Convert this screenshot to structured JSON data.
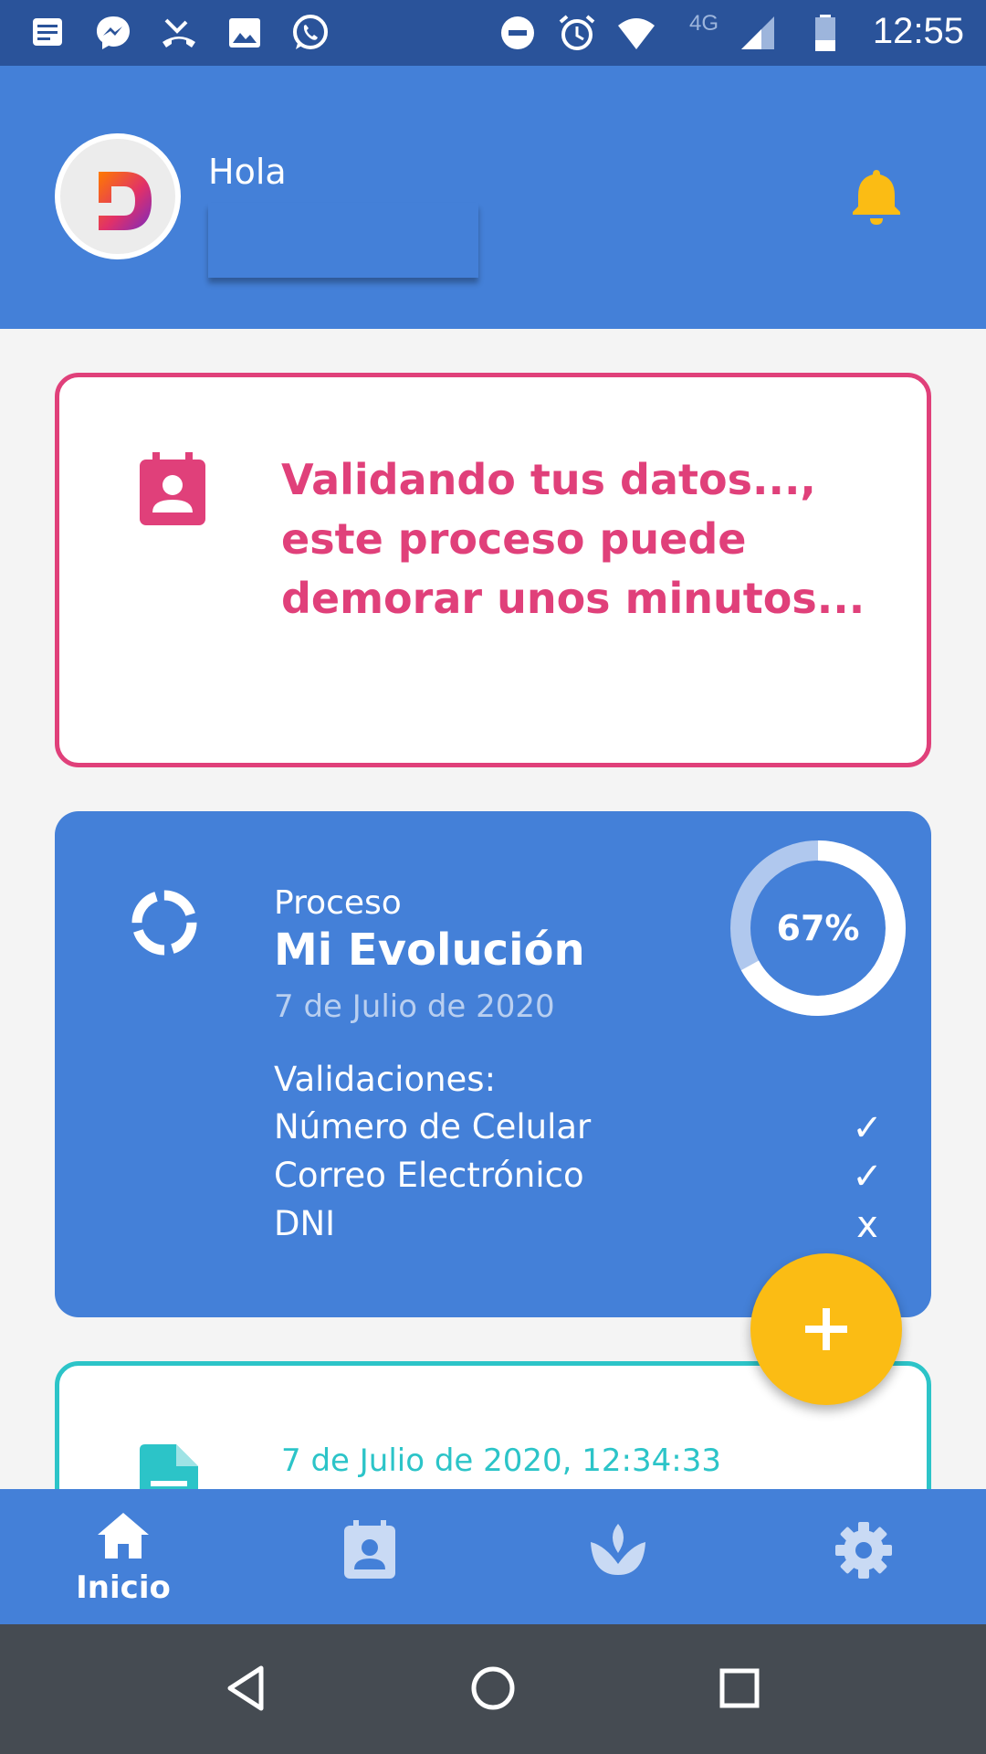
{
  "status_bar": {
    "time": "12:55",
    "network": "4G",
    "icons": [
      "notes-icon",
      "messenger-icon",
      "missed-call-icon",
      "image-icon",
      "whatsapp-icon",
      "do-not-disturb-icon",
      "alarm-icon",
      "wifi-icon",
      "signal-icon",
      "battery-icon"
    ]
  },
  "header": {
    "greeting": "Hola",
    "username": "",
    "bell_color": "#fbbc14",
    "bg_color": "#4480d8"
  },
  "validation_card": {
    "message": "Validando tus datos..., este proceso puede demorar unos minutos...",
    "icon": "contact-calendar-icon",
    "color": "#e0407a"
  },
  "process_card": {
    "label": "Proceso",
    "title": "Mi Evolución",
    "date": "7 de Julio de 2020",
    "progress_percent": 67,
    "progress_text": "67%",
    "validations_title": "Validaciones:",
    "validations": [
      {
        "name": "Número de Celular",
        "mark": "✓"
      },
      {
        "name": "Correo Electrónico",
        "mark": "✓"
      },
      {
        "name": "DNI",
        "mark": "x"
      }
    ]
  },
  "fab": {
    "icon": "plus-icon",
    "color": "#fbbc14"
  },
  "history_card": {
    "date": "7 de Julio de 2020, 12:34:33",
    "icon": "document-icon",
    "color": "#2cc4c8"
  },
  "bottom_nav": {
    "items": [
      {
        "label": "Inicio",
        "icon": "home-icon"
      },
      {
        "label": "",
        "icon": "contact-calendar-icon"
      },
      {
        "label": "",
        "icon": "lotus-icon"
      },
      {
        "label": "",
        "icon": "gear-icon"
      }
    ]
  },
  "system_nav": {
    "icons": [
      "back-icon",
      "home-circle-icon",
      "recents-icon"
    ]
  }
}
